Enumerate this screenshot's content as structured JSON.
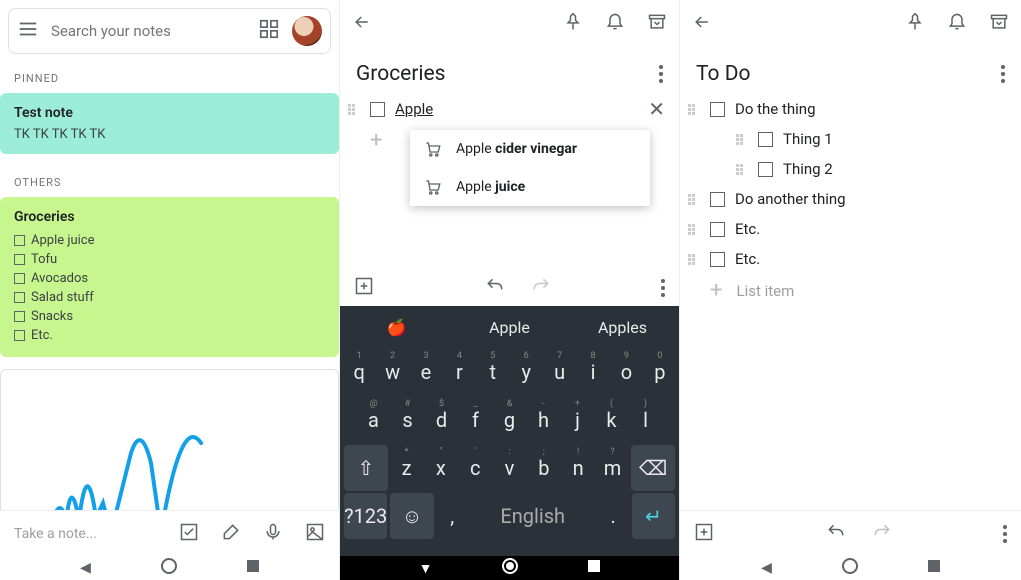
{
  "p1": {
    "search_placeholder": "Search your notes",
    "pinned_label": "PINNED",
    "others_label": "OTHERS",
    "pinned_note": {
      "title": "Test note",
      "body": "TK TK TK TK TK"
    },
    "groceries": {
      "title": "Groceries",
      "items": [
        "Apple juice",
        "Tofu",
        "Avocados",
        "Salad stuff",
        "Snacks",
        "Etc."
      ]
    },
    "take_note": "Take a note..."
  },
  "p2": {
    "title": "Groceries",
    "input_value": "Apple",
    "suggestions": [
      {
        "prefix": "Apple ",
        "bold": "cider vinegar"
      },
      {
        "prefix": "Apple ",
        "bold": "juice"
      }
    ],
    "kbd": {
      "emoji": "🍎",
      "pred_center": "Apple",
      "pred_right": "Apples",
      "row1_hints": [
        "1",
        "2",
        "3",
        "4",
        "5",
        "6",
        "7",
        "8",
        "9",
        "0"
      ],
      "row1": [
        "q",
        "w",
        "e",
        "r",
        "t",
        "y",
        "u",
        "i",
        "o",
        "p"
      ],
      "row2_hints": [
        "@",
        "#",
        "$",
        "_",
        "&",
        "-",
        "+",
        "(",
        ")"
      ],
      "row2": [
        "a",
        "s",
        "d",
        "f",
        "g",
        "h",
        "j",
        "k",
        "l"
      ],
      "row3_hints": [
        "*",
        "\"",
        "'",
        ":",
        ";",
        "!",
        "?"
      ],
      "row3": [
        "z",
        "x",
        "c",
        "v",
        "b",
        "n",
        "m"
      ],
      "sym": "?123",
      "space": "English"
    }
  },
  "p3": {
    "title": "To Do",
    "items": [
      {
        "indent": 0,
        "text": "Do the thing"
      },
      {
        "indent": 1,
        "text": "Thing 1"
      },
      {
        "indent": 1,
        "text": "Thing 2"
      },
      {
        "indent": 0,
        "text": "Do another thing"
      },
      {
        "indent": 0,
        "text": "Etc."
      },
      {
        "indent": 0,
        "text": "Etc."
      }
    ],
    "add_label": "List item"
  }
}
